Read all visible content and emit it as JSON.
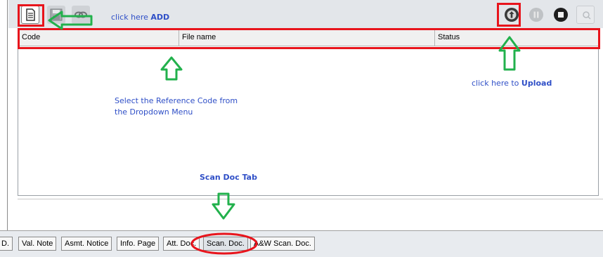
{
  "toolbar": {
    "add_hint_prefix": "click here ",
    "add_hint_bold": "ADD",
    "buttons": [
      "new-document-icon",
      "save-icon",
      "link-icon",
      "upload-icon",
      "pause-icon",
      "stop-icon",
      "search-icon"
    ]
  },
  "table": {
    "columns": [
      "Code",
      "File name",
      "Status"
    ]
  },
  "annotations": {
    "select_line1": "Select the Reference Code from",
    "select_line2": "the Dropdown Menu",
    "upload_prefix": "click here to ",
    "upload_bold": "Upload",
    "scan_doc_tab": "Scan Doc Tab"
  },
  "tabs": [
    "D.",
    "Val. Note",
    "Asmt. Notice",
    "Info. Page",
    "Att. Doc.",
    "Scan. Doc.",
    "A&W Scan. Doc."
  ],
  "colors": {
    "annotation_red": "#e8141c",
    "annotation_green": "#22b14c",
    "annotation_blue": "#2f4fc7"
  }
}
